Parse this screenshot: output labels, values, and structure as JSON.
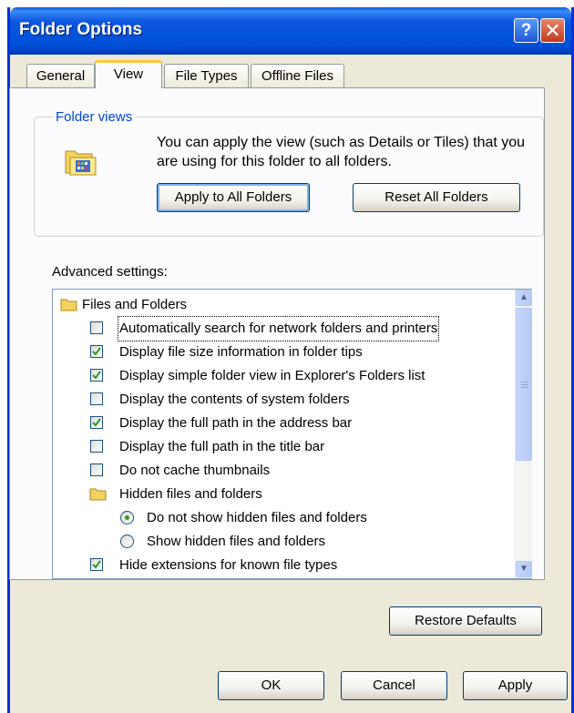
{
  "window": {
    "title": "Folder Options",
    "help_symbol": "?",
    "close_symbol": "✕"
  },
  "tabs": [
    {
      "label": "General",
      "active": false
    },
    {
      "label": "View",
      "active": true
    },
    {
      "label": "File Types",
      "active": false
    },
    {
      "label": "Offline Files",
      "active": false
    }
  ],
  "folder_views": {
    "legend": "Folder views",
    "description": "You can apply the view (such as Details or Tiles) that you are using for this folder to all folders.",
    "apply_label": "Apply to All Folders",
    "reset_label": "Reset All Folders"
  },
  "advanced": {
    "label": "Advanced settings:",
    "items": [
      {
        "type": "folder",
        "label": "Files and Folders"
      },
      {
        "type": "checkbox",
        "label": "Automatically search for network folders and printers",
        "checked": false,
        "focused": true
      },
      {
        "type": "checkbox",
        "label": "Display file size information in folder tips",
        "checked": true
      },
      {
        "type": "checkbox",
        "label": "Display simple folder view in Explorer's Folders list",
        "checked": true
      },
      {
        "type": "checkbox",
        "label": "Display the contents of system folders",
        "checked": false
      },
      {
        "type": "checkbox",
        "label": "Display the full path in the address bar",
        "checked": true
      },
      {
        "type": "checkbox",
        "label": "Display the full path in the title bar",
        "checked": false
      },
      {
        "type": "checkbox",
        "label": "Do not cache thumbnails",
        "checked": false
      },
      {
        "type": "subfolder",
        "label": "Hidden files and folders"
      },
      {
        "type": "radio",
        "label": "Do not show hidden files and folders",
        "selected": true
      },
      {
        "type": "radio",
        "label": "Show hidden files and folders",
        "selected": false
      },
      {
        "type": "checkbox",
        "label": "Hide extensions for known file types",
        "checked": true
      }
    ],
    "restore_label": "Restore Defaults"
  },
  "footer": {
    "ok_label": "OK",
    "cancel_label": "Cancel",
    "apply_label": "Apply"
  },
  "colors": {
    "title_bar": "#0050d8",
    "window_border": "#0831d9",
    "tab_highlight": "#ffc83c",
    "check_mark": "#21a121",
    "legend_text": "#0046d5"
  }
}
